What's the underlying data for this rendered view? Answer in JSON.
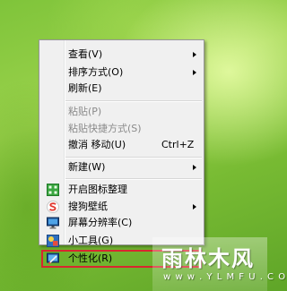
{
  "context_menu": {
    "items": [
      {
        "label": "查看(V)"
      },
      {
        "label": "排序方式(O)"
      },
      {
        "label": "刷新(E)"
      },
      {
        "label": "粘贴(P)"
      },
      {
        "label": "粘贴快捷方式(S)"
      },
      {
        "label": "撤消 移动(U)",
        "shortcut": "Ctrl+Z"
      },
      {
        "label": "新建(W)"
      },
      {
        "label": "开启图标整理",
        "icon": "grid-icon"
      },
      {
        "label": "搜狗壁纸",
        "icon": "sogou-wallpaper-icon"
      },
      {
        "label": "屏幕分辨率(C)",
        "icon": "monitor-icon"
      },
      {
        "label": "小工具(G)",
        "icon": "gadgets-icon"
      },
      {
        "label": "个性化(R)",
        "icon": "personalize-icon"
      }
    ],
    "highlight_color": "#d8262f"
  },
  "watermark": {
    "title": "雨林木风",
    "url": "w w w . Y L M F U . C O M"
  }
}
